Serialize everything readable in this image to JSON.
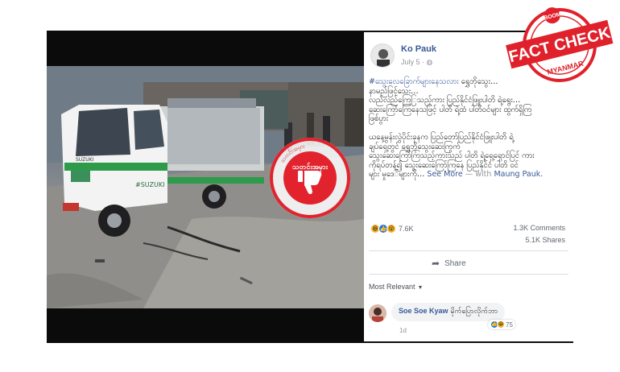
{
  "stamp": {
    "brand": "BOOM",
    "title": "FACT CHECK",
    "subtitle": "MYANMAR",
    "color": "#e0212b"
  },
  "seal": {
    "center_text": "သတင်းအမှား",
    "ring_text": "သတင်းအမှား",
    "color": "#e2232e"
  },
  "photo": {
    "vehicle_brand": "SUZUKI",
    "vehicle_side_text": "#SUZUKI"
  },
  "post": {
    "author": "Ko Pauk",
    "date": "July 5",
    "privacy_icon": "globe-icon",
    "hashtag": "#သွေးလေခြောက်များနေသလား",
    "text_line_1": " ရွှေဘိုသွေး…",
    "text_p1": "နာမည်ဖြင့်သေး…\nလည်လည်ကြေြသည့်ကား ပြည်နိုင်ငံဖြူးပါတိ ရဲ့ရွေး…\nဆေးကြော်ကြေနေသဖြင့် ပါတိ ရဲ့ထံ ပါတိဝင်များ ထွက်ရှိကြ\nဖြစ်ပွား",
    "text_p2": "ယနေ့မွန်းလွဲပိုင်းခုနက ပြည်တော်ပြည်နိုင်ငံဖြူးပါတိ ရဲ့\nချပ်ရှေ့တွင် ရွှေဘိုသွေးဆေးကြွက်\nသွေးဆေးကြော်ကြသည့်ကားသည် ပါတိ ရဲ့ရှေ့ရှောင်ပြင် ကား\nကိုရပ်တန့်၍ သွေးဆေးကြော်ကြနေ ပြည်နိုင်ငံ ပါတိ ဝင်\nများ မှုဒေ်များကို…",
    "see_more": "See More",
    "with_label": "— with",
    "with_name": "Maung Pauk.",
    "reaction_count": "7.6K",
    "comments": "1.3K Comments",
    "shares": "5.1K Shares",
    "share_label": "Share",
    "sort_label": "Most Relevant",
    "comment": {
      "name": "Soe Soe Kyaw",
      "text": "မိုက်ပြောလိုက်ဘာ",
      "time": "1d",
      "reaction_count": "75"
    }
  },
  "colors": {
    "link_blue": "#385898",
    "meta_gray": "#90949c",
    "background_dark": "#0e0e0e"
  }
}
